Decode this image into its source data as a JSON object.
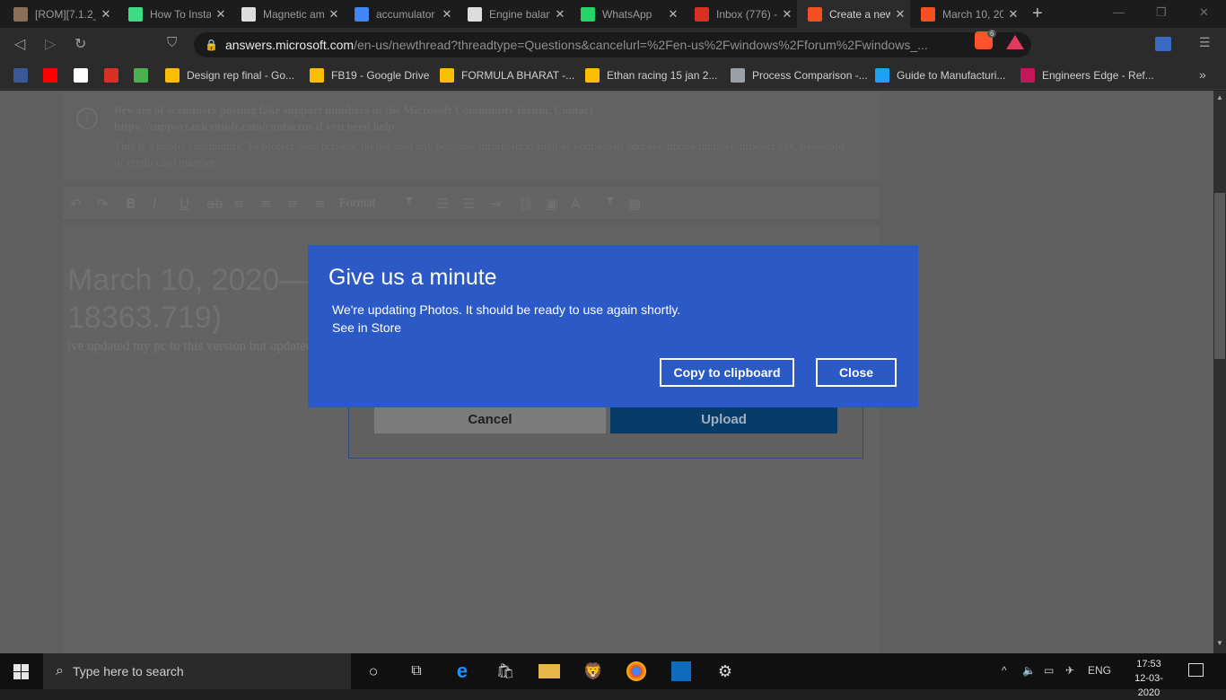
{
  "browser": {
    "tabs": [
      {
        "title": "[ROM][7.1.2_",
        "favicon": "rom-icon",
        "color": "#8a6e57"
      },
      {
        "title": "How To Insta",
        "favicon": "android-icon",
        "color": "#3ddc84"
      },
      {
        "title": "Magnetic am",
        "favicon": "wikipedia-icon",
        "color": "#dddddd"
      },
      {
        "title": "accumulator",
        "favicon": "google-icon",
        "color": "#4285f4"
      },
      {
        "title": "Engine balan",
        "favicon": "wikipedia-icon",
        "color": "#dddddd"
      },
      {
        "title": "WhatsApp",
        "favicon": "whatsapp-icon",
        "color": "#25d366"
      },
      {
        "title": "Inbox (776) -",
        "favicon": "gmail-icon",
        "color": "#d93025"
      },
      {
        "title": "Create a new",
        "favicon": "microsoft-icon",
        "color": "#f25022"
      },
      {
        "title": "March 10, 20",
        "favicon": "microsoft-icon",
        "color": "#f25022"
      }
    ],
    "tab_close": "✕",
    "new_tab": "+",
    "url": {
      "host": "answers.microsoft.com",
      "path": "/en-us/newthread?threadtype=Questions&cancelurl=%2Fen-us%2Fwindows%2Fforum%2Fwindows_..."
    },
    "brave_badge": "6",
    "bookmarks": [
      {
        "label": "",
        "icon": "facebook-icon",
        "color": "#3b5998"
      },
      {
        "label": "",
        "icon": "youtube-icon",
        "color": "#ff0000"
      },
      {
        "label": "",
        "icon": "google-icon",
        "color": "#ffffff"
      },
      {
        "label": "",
        "icon": "gmail-icon",
        "color": "#d93025"
      },
      {
        "label": "",
        "icon": "sheets-icon",
        "color": "#4caf50"
      },
      {
        "label": "Design rep final - Go...",
        "icon": "drive-icon",
        "color": "#fbbc04"
      },
      {
        "label": "FB19 - Google Drive",
        "icon": "drive-icon",
        "color": "#fbbc04"
      },
      {
        "label": "FORMULA BHARAT -...",
        "icon": "drive-icon",
        "color": "#fbbc04"
      },
      {
        "label": "Ethan racing 15 jan 2...",
        "icon": "drive-icon",
        "color": "#fbbc04"
      },
      {
        "label": "Process Comparison -...",
        "icon": "doc-icon",
        "color": "#9aa0a6"
      },
      {
        "label": "Guide to Manufacturi...",
        "icon": "bird-icon",
        "color": "#1da1f2"
      },
      {
        "label": "Engineers Edge - Ref...",
        "icon": "ee-icon",
        "color": "#c2185b"
      }
    ],
    "more": "»"
  },
  "page": {
    "notice_warning": "Beware of scammers posting fake support numbers in the Microsoft Community forum. Contact https://support.microsoft.com/contactus if you need help.",
    "notice_privacy": "This is a public community. To protect your privacy, do not post any personal information such as your email address, phone number, product key, password, or credit card number.",
    "editor_format": "Format",
    "post_title": "March 10, 2020—\n18363.719)",
    "post_body": " ive updated my pc to this version but updated.",
    "cancel_label": "Cancel",
    "upload_label": "Upload"
  },
  "dialog": {
    "title": "Give us a minute",
    "message": "We're updating Photos. It should be ready to use again shortly.",
    "link": "See in Store",
    "copy_button": "Copy to clipboard",
    "close_button": "Close"
  },
  "taskbar": {
    "search_placeholder": "Type here to search",
    "language": "ENG",
    "time": "17:53",
    "date": "12-03-2020"
  }
}
